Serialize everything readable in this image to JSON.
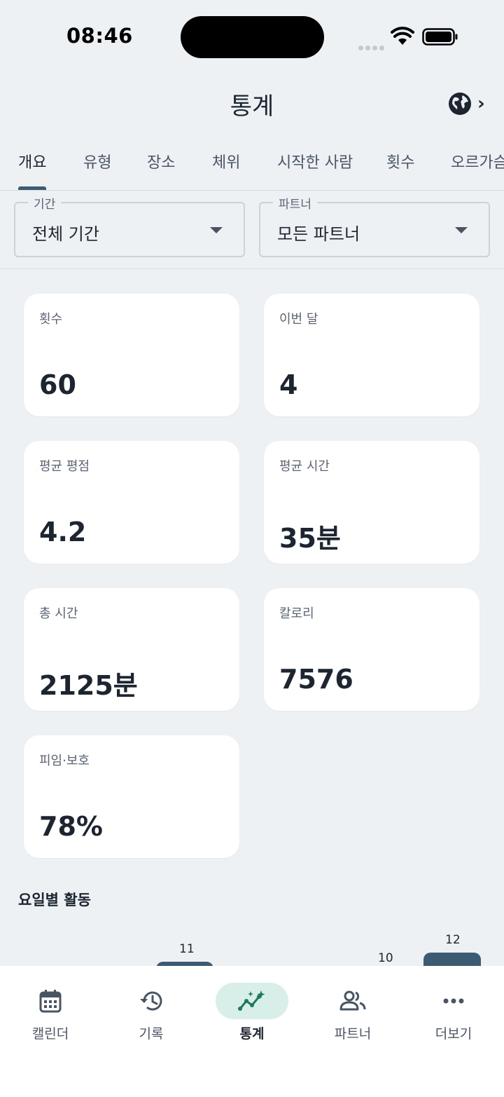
{
  "status_bar": {
    "time": "08:46"
  },
  "header": {
    "title": "통계"
  },
  "tabs": [
    {
      "label": "개요"
    },
    {
      "label": "유형"
    },
    {
      "label": "장소"
    },
    {
      "label": "체위"
    },
    {
      "label": "시작한 사람"
    },
    {
      "label": "횟수"
    },
    {
      "label": "오르가슴"
    }
  ],
  "filters": {
    "period": {
      "label": "기간",
      "value": "전체 기간"
    },
    "partner": {
      "label": "파트너",
      "value": "모든 파트너"
    }
  },
  "stats": [
    {
      "label": "횟수",
      "value": "60"
    },
    {
      "label": "이번 달",
      "value": "4"
    },
    {
      "label": "평균 평점",
      "value": "4.2"
    },
    {
      "label": "평균 시간",
      "value": "35분"
    },
    {
      "label": "총 시간",
      "value": "2125분"
    },
    {
      "label": "칼로리",
      "value": "7576"
    },
    {
      "label": "피임·보호",
      "value": "78%"
    }
  ],
  "weekday_section": {
    "title": "요일별 활동",
    "visible_bar_labels": [
      "11",
      "10",
      "12"
    ]
  },
  "bottom_nav": [
    {
      "label": "캘린더",
      "icon": "calendar-icon"
    },
    {
      "label": "기록",
      "icon": "history-icon"
    },
    {
      "label": "통계",
      "icon": "stats-icon"
    },
    {
      "label": "파트너",
      "icon": "partners-icon"
    },
    {
      "label": "더보기",
      "icon": "more-icon"
    }
  ],
  "colors": {
    "background": "#eef1f4",
    "accent": "#3d5a73",
    "nav_active_pill": "#d7efe8",
    "stats_icon_green": "#1e7a5e"
  }
}
